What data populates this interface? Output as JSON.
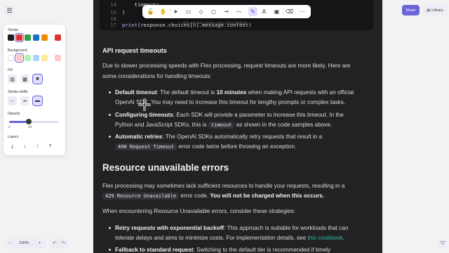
{
  "canvas": {
    "code": {
      "line14_num": "14",
      "line14_text": "    timeout=",
      "line15_num": "15",
      "line15_text": ")",
      "line16_num": "16",
      "line17_num": "17",
      "line17_a": "print",
      "line17_b": "(response.choices[",
      "line17_c": "0",
      "line17_d": "].message.content)"
    },
    "timeouts": {
      "heading": "API request timeouts",
      "intro_1": "Due to slower processing speeds with Flex processing, request timeouts are more likely. Here are",
      "intro_2": "some considerations for handling timeouts:",
      "b1_bold": "Default timeout",
      "b1_a": ": The default timeout is ",
      "b1_bold2": "10 minutes",
      "b1_b": " when making API requests with an official",
      "b1_line2": "OpenAI SDK. You may need to increase this timeout for lengthy prompts or complex tasks.",
      "b2_bold": "Configuring timeouts",
      "b2_a": ": Each SDK will provide a parameter to increase this timeout. In the",
      "b2_line2a": "Python and JavaScript SDKs, this is ",
      "b2_code": "timeout",
      "b2_line2b": " as shown in the code samples above.",
      "b3_bold": "Automatic retries",
      "b3_a": ": The OpenAI SDKs automatically retry requests that result in a",
      "b3_code": "408 Request Timeout",
      "b3_b": " error code twice before throwing an exception."
    },
    "resource": {
      "heading": "Resource unavailable errors",
      "p1_a": "Flex processing may sometimes lack sufficient resources to handle your requests, resulting in a",
      "p1_code": "429 Resource Unavailable",
      "p1_b": " error code. ",
      "p1_bold": "You will not be charged when this occurs.",
      "p2": "When encountering Resource Unavailable errors, consider these strategies:",
      "b1_bold": "Retry requests with exponential backoff",
      "b1_a": ": This approach is suitable for workloads that can",
      "b1_line2a": "tolerate delays and aims to minimize costs. For implementation details, see ",
      "b1_link": "this cookbook",
      "b1_line2b": ".",
      "b2_bold": "Fallback to standard request",
      "b2_a": ": Switching to the default tier is recommended if timely"
    }
  },
  "toolbar": {
    "tools": [
      {
        "name": "lock-tool",
        "glyph": "🔓"
      },
      {
        "name": "hand-tool",
        "glyph": "✋"
      },
      {
        "name": "selection-tool",
        "glyph": "➤"
      },
      {
        "name": "rectangle-tool",
        "glyph": "▭"
      },
      {
        "name": "diamond-tool",
        "glyph": "◇"
      },
      {
        "name": "ellipse-tool",
        "glyph": "○"
      },
      {
        "name": "arrow-tool",
        "glyph": "→"
      },
      {
        "name": "line-tool",
        "glyph": "—"
      },
      {
        "name": "draw-tool",
        "glyph": "✎"
      },
      {
        "name": "text-tool",
        "glyph": "A"
      },
      {
        "name": "image-tool",
        "glyph": "▣"
      },
      {
        "name": "eraser-tool",
        "glyph": "⌫"
      },
      {
        "name": "more-tools",
        "glyph": "⋯"
      }
    ],
    "active_tool": "draw-tool",
    "hint": "Click and drag, release when you've finished"
  },
  "panel": {
    "stroke_label": "Stroke",
    "stroke_colors": [
      "#1e1e1e",
      "#e03131",
      "#2f9e44",
      "#1971c2",
      "#f08c00"
    ],
    "stroke_current": "#e03131",
    "background_label": "Background",
    "background_colors": [
      "#ffffff",
      "#ffc9c9",
      "#b2f2bb",
      "#a5d8ff",
      "#ffec99"
    ],
    "background_current": "#ffc9c9",
    "fill_label": "Fill",
    "stroke_width_label": "Stroke width",
    "opacity_label": "Opacity",
    "opacity_min": "0",
    "opacity_value": "40",
    "opacity_fraction": 0.4,
    "layers_label": "Layers"
  },
  "bottom": {
    "zoom_out": "−",
    "zoom_level": "116%",
    "zoom_in": "+",
    "undo": "↶",
    "redo": "↷"
  },
  "top_right": {
    "share_label": "Share",
    "library_label": "Library"
  },
  "colors": {
    "accent": "#6965db",
    "doc_bg": "#222225",
    "link": "#2fb59b"
  }
}
